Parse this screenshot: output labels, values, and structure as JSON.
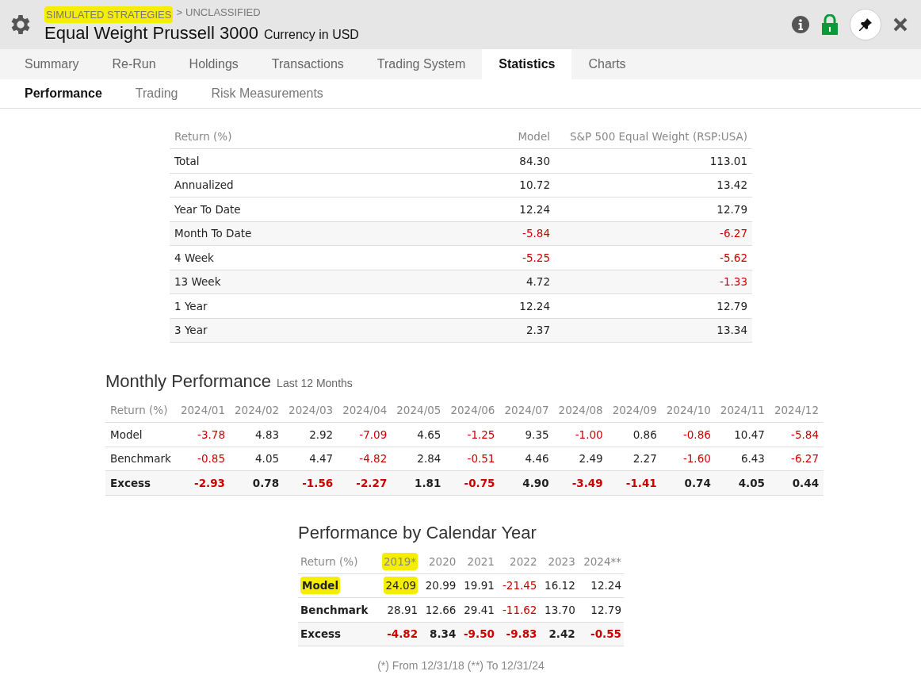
{
  "header": {
    "breadcrumb": [
      {
        "text": "SIMULATED STRATEGIES",
        "highlighted": true
      },
      {
        "text": ">",
        "highlighted": false
      },
      {
        "text": "UNCLASSIFIED",
        "highlighted": false
      }
    ],
    "title": "Equal Weight Prussell 3000",
    "subtitle": "Currency in USD"
  },
  "tabs": [
    {
      "label": "Summary",
      "selected": false
    },
    {
      "label": "Re-Run",
      "selected": false
    },
    {
      "label": "Holdings",
      "selected": false
    },
    {
      "label": "Transactions",
      "selected": false
    },
    {
      "label": "Trading System",
      "selected": false
    },
    {
      "label": "Statistics",
      "selected": true
    },
    {
      "label": "Charts",
      "selected": false
    }
  ],
  "subtabs": [
    {
      "label": "Performance",
      "selected": true
    },
    {
      "label": "Trading",
      "selected": false
    },
    {
      "label": "Risk Measurements",
      "selected": false
    }
  ],
  "returns_table": {
    "row_header": "Return (%)",
    "columns": [
      "Model",
      "S&P 500 Equal Weight (RSP:USA)"
    ],
    "rows": [
      {
        "label": "Total",
        "cells": [
          {
            "text": "84.30",
            "negative": false
          },
          {
            "text": "113.01",
            "negative": false
          }
        ]
      },
      {
        "label": "Annualized",
        "cells": [
          {
            "text": "10.72",
            "negative": false
          },
          {
            "text": "13.42",
            "negative": false
          }
        ]
      },
      {
        "label": "Year To Date",
        "cells": [
          {
            "text": "12.24",
            "negative": false
          },
          {
            "text": "12.79",
            "negative": false
          }
        ]
      },
      {
        "label": "Month To Date",
        "cells": [
          {
            "text": "-5.84",
            "negative": true
          },
          {
            "text": "-6.27",
            "negative": true
          }
        ]
      },
      {
        "label": "4 Week",
        "cells": [
          {
            "text": "-5.25",
            "negative": true
          },
          {
            "text": "-5.62",
            "negative": true
          }
        ]
      },
      {
        "label": "13 Week",
        "cells": [
          {
            "text": "4.72",
            "negative": false
          },
          {
            "text": "-1.33",
            "negative": true
          }
        ]
      },
      {
        "label": "1 Year",
        "cells": [
          {
            "text": "12.24",
            "negative": false
          },
          {
            "text": "12.79",
            "negative": false
          }
        ]
      },
      {
        "label": "3 Year",
        "cells": [
          {
            "text": "2.37",
            "negative": false
          },
          {
            "text": "13.34",
            "negative": false
          }
        ]
      }
    ]
  },
  "monthly": {
    "title": "Monthly Performance",
    "subtitle": "Last 12 Months",
    "row_header": "Return (%)",
    "columns": [
      {
        "text": "2024/01",
        "highlighted": false
      },
      {
        "text": "2024/02",
        "highlighted": false
      },
      {
        "text": "2024/03",
        "highlighted": false
      },
      {
        "text": "2024/04",
        "highlighted": false
      },
      {
        "text": "2024/05",
        "highlighted": false
      },
      {
        "text": "2024/06",
        "highlighted": false
      },
      {
        "text": "2024/07",
        "highlighted": false
      },
      {
        "text": "2024/08",
        "highlighted": false
      },
      {
        "text": "2024/09",
        "highlighted": false
      },
      {
        "text": "2024/10",
        "highlighted": false
      },
      {
        "text": "2024/11",
        "highlighted": false
      },
      {
        "text": "2024/12",
        "highlighted": false
      }
    ],
    "rows": [
      {
        "label": "Model",
        "label_bold": false,
        "values_bold": false,
        "shaded": false,
        "label_highlighted": false,
        "cells": [
          {
            "text": "-3.78",
            "negative": true,
            "highlighted": false
          },
          {
            "text": "4.83",
            "negative": false,
            "highlighted": false
          },
          {
            "text": "2.92",
            "negative": false,
            "highlighted": false
          },
          {
            "text": "-7.09",
            "negative": true,
            "highlighted": false
          },
          {
            "text": "4.65",
            "negative": false,
            "highlighted": false
          },
          {
            "text": "-1.25",
            "negative": true,
            "highlighted": false
          },
          {
            "text": "9.35",
            "negative": false,
            "highlighted": false
          },
          {
            "text": "-1.00",
            "negative": true,
            "highlighted": false
          },
          {
            "text": "0.86",
            "negative": false,
            "highlighted": false
          },
          {
            "text": "-0.86",
            "negative": true,
            "highlighted": false
          },
          {
            "text": "10.47",
            "negative": false,
            "highlighted": false
          },
          {
            "text": "-5.84",
            "negative": true,
            "highlighted": false
          }
        ]
      },
      {
        "label": "Benchmark",
        "label_bold": false,
        "values_bold": false,
        "shaded": false,
        "label_highlighted": false,
        "cells": [
          {
            "text": "-0.85",
            "negative": true,
            "highlighted": false
          },
          {
            "text": "4.05",
            "negative": false,
            "highlighted": false
          },
          {
            "text": "4.47",
            "negative": false,
            "highlighted": false
          },
          {
            "text": "-4.82",
            "negative": true,
            "highlighted": false
          },
          {
            "text": "2.84",
            "negative": false,
            "highlighted": false
          },
          {
            "text": "-0.51",
            "negative": true,
            "highlighted": false
          },
          {
            "text": "4.46",
            "negative": false,
            "highlighted": false
          },
          {
            "text": "2.49",
            "negative": false,
            "highlighted": false
          },
          {
            "text": "2.27",
            "negative": false,
            "highlighted": false
          },
          {
            "text": "-1.60",
            "negative": true,
            "highlighted": false
          },
          {
            "text": "6.43",
            "negative": false,
            "highlighted": false
          },
          {
            "text": "-6.27",
            "negative": true,
            "highlighted": false
          }
        ]
      },
      {
        "label": "Excess",
        "label_bold": true,
        "values_bold": true,
        "shaded": true,
        "label_highlighted": false,
        "cells": [
          {
            "text": "-2.93",
            "negative": true,
            "highlighted": false
          },
          {
            "text": "0.78",
            "negative": false,
            "highlighted": false
          },
          {
            "text": "-1.56",
            "negative": true,
            "highlighted": false
          },
          {
            "text": "-2.27",
            "negative": true,
            "highlighted": false
          },
          {
            "text": "1.81",
            "negative": false,
            "highlighted": false
          },
          {
            "text": "-0.75",
            "negative": true,
            "highlighted": false
          },
          {
            "text": "4.90",
            "negative": false,
            "highlighted": false
          },
          {
            "text": "-3.49",
            "negative": true,
            "highlighted": false
          },
          {
            "text": "-1.41",
            "negative": true,
            "highlighted": false
          },
          {
            "text": "0.74",
            "negative": false,
            "highlighted": false
          },
          {
            "text": "4.05",
            "negative": false,
            "highlighted": false
          },
          {
            "text": "0.44",
            "negative": false,
            "highlighted": false
          }
        ]
      }
    ]
  },
  "calendar": {
    "title": "Performance by Calendar Year",
    "row_header": "Return (%)",
    "columns": [
      {
        "text": "2019*",
        "highlighted": true
      },
      {
        "text": "2020",
        "highlighted": false
      },
      {
        "text": "2021",
        "highlighted": false
      },
      {
        "text": "2022",
        "highlighted": false
      },
      {
        "text": "2023",
        "highlighted": false
      },
      {
        "text": "2024**",
        "highlighted": false
      }
    ],
    "rows": [
      {
        "label": "Model",
        "label_bold": true,
        "values_bold": false,
        "shaded": false,
        "label_highlighted": true,
        "cells": [
          {
            "text": "24.09",
            "negative": false,
            "highlighted": true
          },
          {
            "text": "20.99",
            "negative": false,
            "highlighted": false
          },
          {
            "text": "19.91",
            "negative": false,
            "highlighted": false
          },
          {
            "text": "-21.45",
            "negative": true,
            "highlighted": false
          },
          {
            "text": "16.12",
            "negative": false,
            "highlighted": false
          },
          {
            "text": "12.24",
            "negative": false,
            "highlighted": false
          }
        ]
      },
      {
        "label": "Benchmark",
        "label_bold": true,
        "values_bold": false,
        "shaded": false,
        "label_highlighted": false,
        "cells": [
          {
            "text": "28.91",
            "negative": false,
            "highlighted": false
          },
          {
            "text": "12.66",
            "negative": false,
            "highlighted": false
          },
          {
            "text": "29.41",
            "negative": false,
            "highlighted": false
          },
          {
            "text": "-11.62",
            "negative": true,
            "highlighted": false
          },
          {
            "text": "13.70",
            "negative": false,
            "highlighted": false
          },
          {
            "text": "12.79",
            "negative": false,
            "highlighted": false
          }
        ]
      },
      {
        "label": "Excess",
        "label_bold": true,
        "values_bold": true,
        "shaded": true,
        "label_highlighted": false,
        "cells": [
          {
            "text": "-4.82",
            "negative": true,
            "highlighted": false
          },
          {
            "text": "8.34",
            "negative": false,
            "highlighted": false
          },
          {
            "text": "-9.50",
            "negative": true,
            "highlighted": false
          },
          {
            "text": "-9.83",
            "negative": true,
            "highlighted": false
          },
          {
            "text": "2.42",
            "negative": false,
            "highlighted": false
          },
          {
            "text": "-0.55",
            "negative": true,
            "highlighted": false
          }
        ]
      }
    ],
    "footnote": "(*) From 12/31/18  (**) To 12/31/24"
  }
}
